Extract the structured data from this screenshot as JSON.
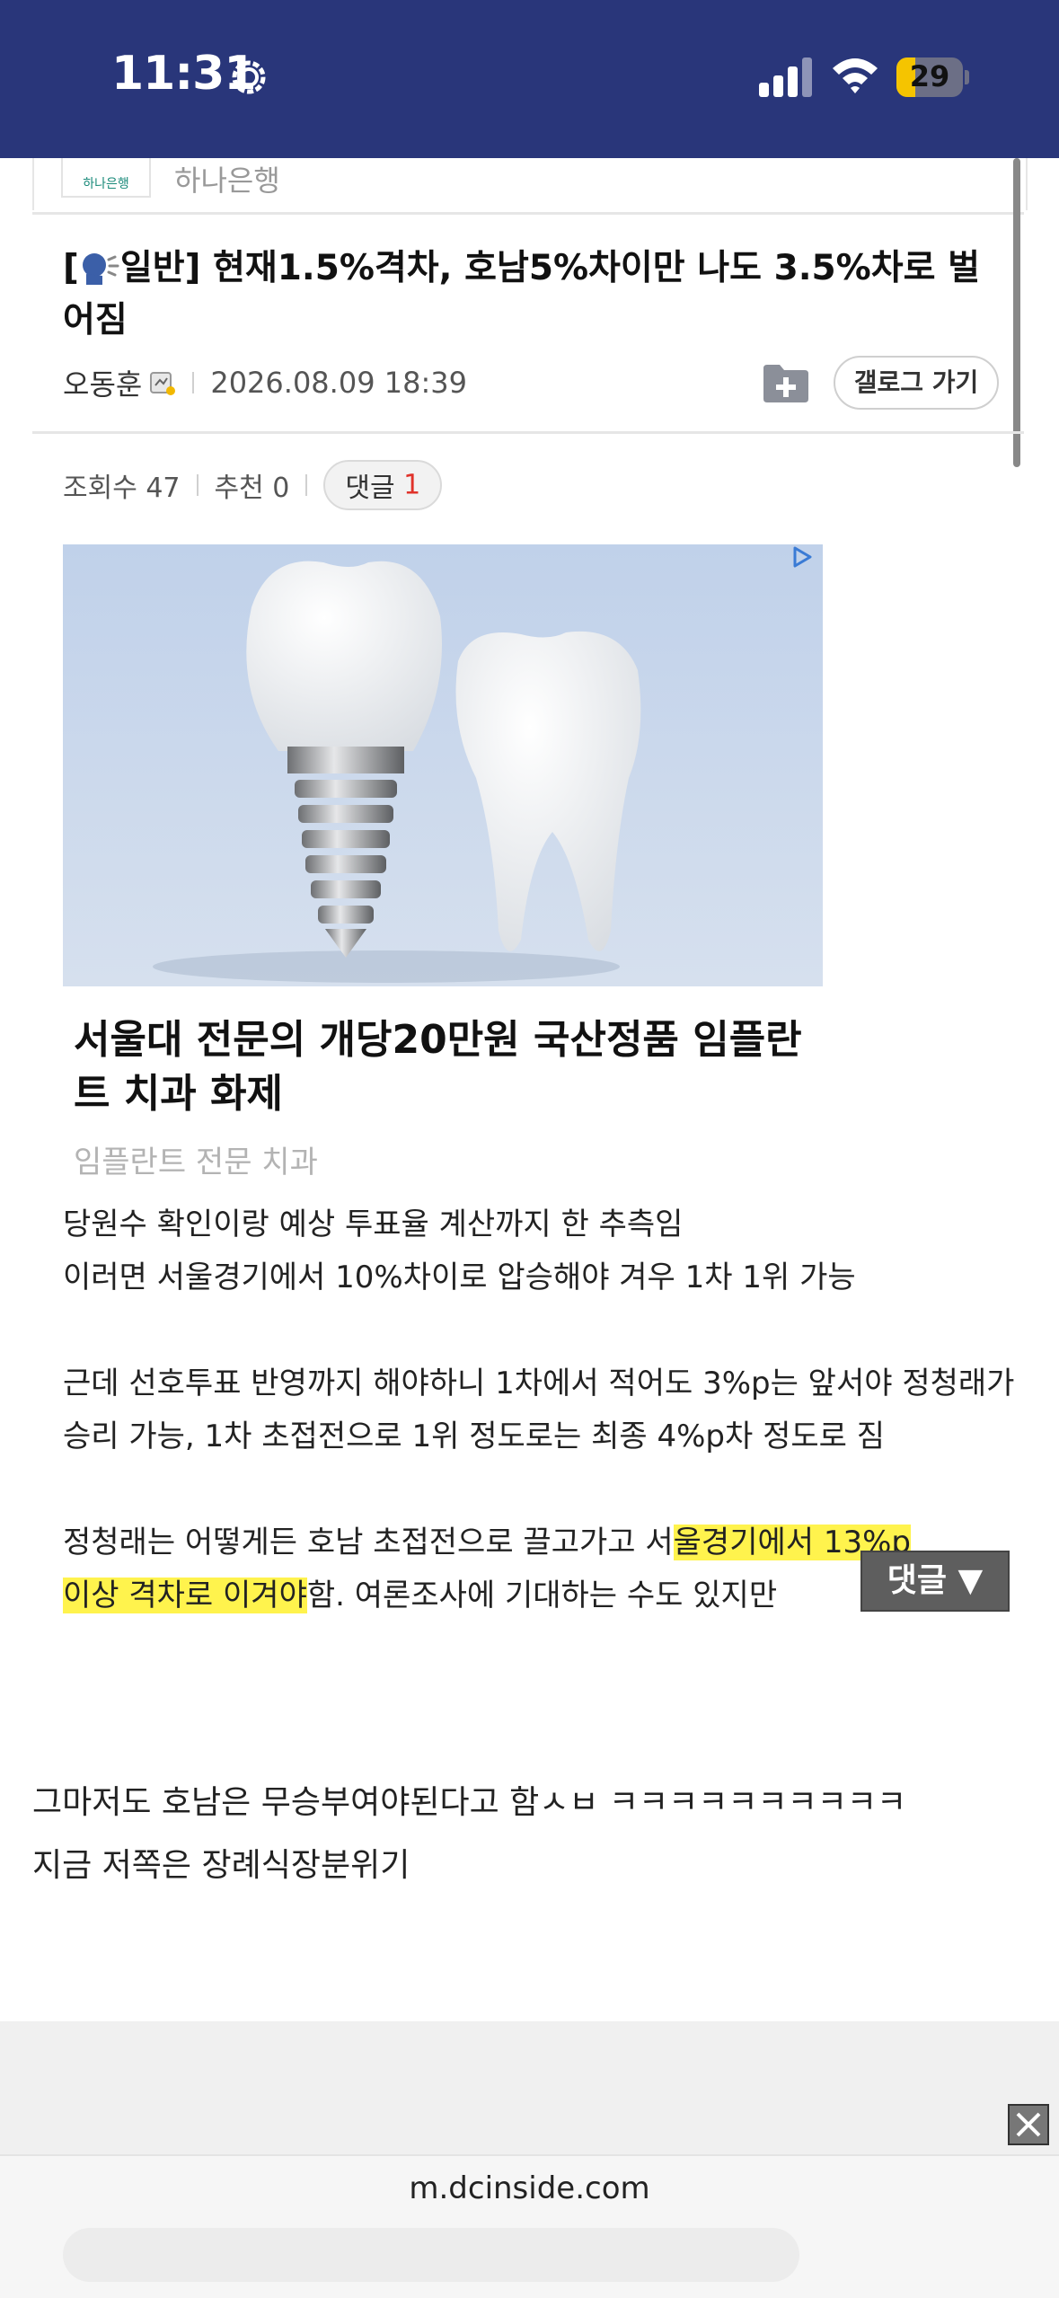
{
  "status": {
    "time": "11:31",
    "battery": "29",
    "battery_level": 0.29
  },
  "bank": {
    "logo_text": "하나은행",
    "name": "하나은행"
  },
  "post": {
    "title_prefix": "[",
    "title_main": "일반] 현재1.5%격차, 호남5%차이만 나도 3.5%차로 벌어짐",
    "author": "오동훈",
    "date": "2026.08.09 18:39",
    "gallery_button": "갤로그 가기",
    "views_label": "조회수 47",
    "recommend_label": "추천 0",
    "comment_label": "댓글",
    "comment_count": "1"
  },
  "ad": {
    "title": "서울대 전문의 개당20만원 국산정품 임플란트 치과 화제",
    "subtitle": "임플란트 전문 치과"
  },
  "body": {
    "line1": "당원수 확인이랑 예상 투표율 계산까지 한 추측임",
    "line2": "이러면 서울경기에서 10%차이로 압승해야 겨우 1차 1위 가능",
    "para2": "근데 선호투표 반영까지 해야하니 1차에서 적어도 3%p는 앞서야 정청래가 승리 가능, 1차 초접전으로 1위 정도로는 최종 4%p차 정도로 짐",
    "p3_a": "정청래는 어떻게든 호남 초접전으로 끌고가고 서",
    "p3_hl1": "울경기에서 13%p",
    "p3_hl2": "이상 격차로 이겨야",
    "p3_b": "함. 여론조사에 기대하는 수도 있지만",
    "comment_float": "댓글 ▼",
    "line_a": "그마저도 호남은 무승부여야된다고 함ㅅㅂ ㅋㅋㅋㅋㅋㅋㅋㅋㅋㅋ",
    "line_b": "지금 저쪽은  장례식장분위기"
  },
  "browser": {
    "url": "m.dcinside.com"
  },
  "colors": {
    "status_bar": "#29367a",
    "highlight": "#fff34d",
    "comment_count": "#e0322a"
  }
}
